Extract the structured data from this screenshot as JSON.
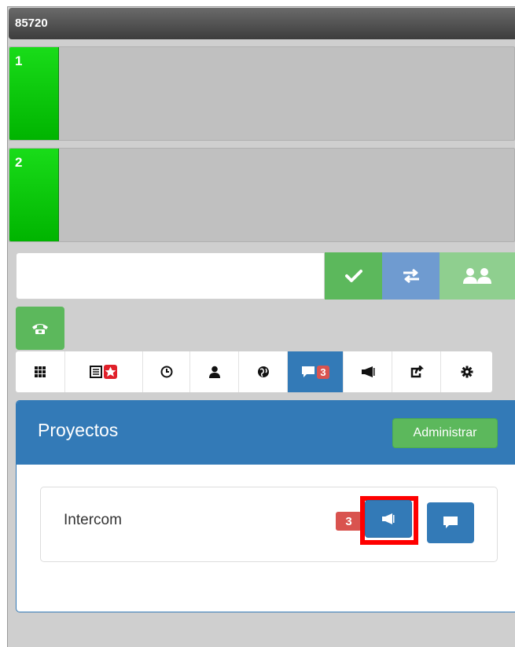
{
  "window": {
    "title": "85720"
  },
  "lines": [
    {
      "label": "1",
      "status": "idle"
    },
    {
      "label": "2",
      "status": "idle"
    }
  ],
  "dial": {
    "input_value": "",
    "buttons": [
      {
        "name": "call",
        "icon": "check-icon",
        "color": "#5cb85c"
      },
      {
        "name": "transfer",
        "icon": "transfer-icon",
        "color": "#6f9bd0"
      },
      {
        "name": "conference",
        "icon": "users-icon",
        "color": "#8fcf8f"
      }
    ]
  },
  "hangup": {
    "icon": "phone-icon",
    "color": "#5cb85c"
  },
  "toolbar": {
    "tabs": [
      {
        "icon": "keypad-icon"
      },
      {
        "icon": "contacts-favorites-icon"
      },
      {
        "icon": "history-clock-icon"
      },
      {
        "icon": "user-icon"
      },
      {
        "icon": "globe-icon"
      },
      {
        "icon": "chat-icon",
        "badge": "3",
        "active": true
      },
      {
        "icon": "megaphone-icon"
      },
      {
        "icon": "share-icon"
      },
      {
        "icon": "gear-icon"
      }
    ],
    "active_color": "#337ab7"
  },
  "projects": {
    "title": "Proyectos",
    "admin_label": "Administrar",
    "items": [
      {
        "name": "Intercom",
        "badge": "3"
      }
    ]
  },
  "colors": {
    "primary": "#337ab7",
    "success": "#5cb85c",
    "danger": "#d9534f",
    "line_green": "#00c800",
    "highlight": "#ff0000"
  }
}
